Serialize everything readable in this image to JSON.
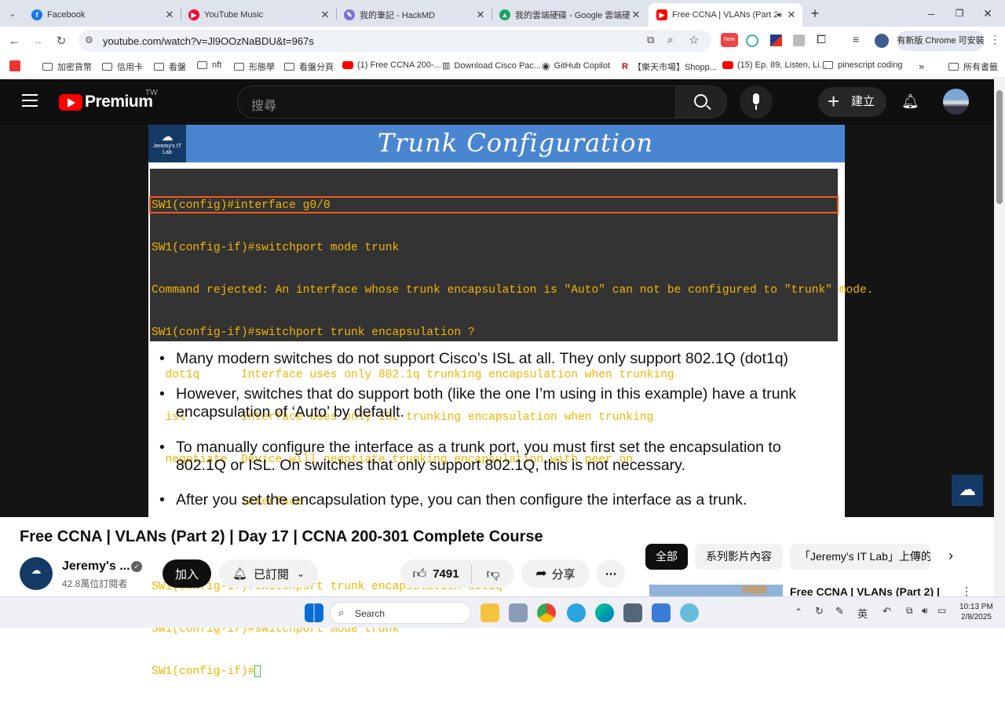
{
  "tabs": [
    {
      "title": "Facebook",
      "color": "#1877f2",
      "glyph": "f"
    },
    {
      "title": "YouTube Music",
      "color": "#ff0033",
      "glyph": "▶"
    },
    {
      "title": "我的筆記 - HackMD",
      "color": "#7c6fd6",
      "glyph": "✎"
    },
    {
      "title": "我的雲端硬碟 - Google 雲端硬碟",
      "color": "#1fa463",
      "glyph": "▲"
    },
    {
      "title": "Free CCNA | VLANs (Part 2)",
      "color": "#ff0000",
      "glyph": "▶"
    }
  ],
  "address": {
    "url": "youtube.com/watch?v=Jl9OOzNaBDU&t=967s",
    "update_label": "有新版 Chrome 可安裝"
  },
  "bookmarks": [
    {
      "label": "加密貨幣",
      "type": "folder"
    },
    {
      "label": "信用卡",
      "type": "folder"
    },
    {
      "label": "看盤",
      "type": "folder"
    },
    {
      "label": "nft",
      "type": "folder"
    },
    {
      "label": "形態學",
      "type": "folder"
    },
    {
      "label": "看盤分頁",
      "type": "folder"
    },
    {
      "label": "(1) Free CCNA 200-...",
      "type": "yt"
    },
    {
      "label": "Download Cisco Pac...",
      "type": "site"
    },
    {
      "label": "GitHub Copilot",
      "type": "site"
    },
    {
      "label": "【樂天市場】Shopp...",
      "type": "site"
    },
    {
      "label": "(15) Ep. 89, Listen, Li...",
      "type": "yt"
    },
    {
      "label": "pinescript coding",
      "type": "folder"
    },
    {
      "label": "所有書籤",
      "type": "folder"
    }
  ],
  "youtube": {
    "brand": "Premium",
    "region": "TW",
    "search_placeholder": "搜尋",
    "create_label": "建立"
  },
  "slide": {
    "logo": "Jeremy's IT Lab",
    "title": "Trunk Configuration",
    "terminal": [
      "SW1(config)#interface g0/0",
      "SW1(config-if)#switchport mode trunk",
      "Command rejected: An interface whose trunk encapsulation is \"Auto\" can not be configured to \"trunk\" mode.",
      "SW1(config-if)#switchport trunk encapsulation ?",
      "  dot1q      Interface uses only 802.1q trunking encapsulation when trunking",
      "  isl        Interface uses only ISL trunking encapsulation when trunking",
      "  negotiate  Device will negotiate trunking encapsulation with peer on",
      "             interface",
      "",
      "SW1(config-if)#switchport trunk encapsulation dot1q",
      "SW1(config-if)#switchport mode trunk",
      "SW1(config-if)#"
    ],
    "bullets": [
      [
        "Many modern switches do not support Cisco’s ISL at all.  They only support 802.1Q (dot1q)"
      ],
      [
        "However, switches that do support both (like the one I’m using in this example) have a trunk",
        "encapsulation of ‘Auto’ by default."
      ],
      [
        "To manually configure the interface as a trunk port, you must first set the encapsulation to",
        "802.1Q or ISL.  On switches that only support 802.1Q, this is not necessary."
      ],
      [
        "After you set the encapsulation type, you can then configure the interface as a trunk."
      ]
    ]
  },
  "video": {
    "title": "Free CCNA | VLANs (Part 2) | Day 17 | CCNA 200-301 Complete Course",
    "channel": "Jeremy's ...",
    "subscribers": "42.8萬位訂閱者",
    "join_label": "加入",
    "subscribed_label": "已訂閱",
    "likes": "7491",
    "share_label": "分享"
  },
  "chips": [
    "全部",
    "系列影片內容",
    "「Jeremy's IT Lab」上傳的"
  ],
  "related_title": "Free CCNA | VLANs (Part 2) |",
  "related_badge": "FREE",
  "taskbar": {
    "search_label": "Search",
    "time": "10:13 PM",
    "date": "2/8/2025",
    "ime": "英"
  }
}
